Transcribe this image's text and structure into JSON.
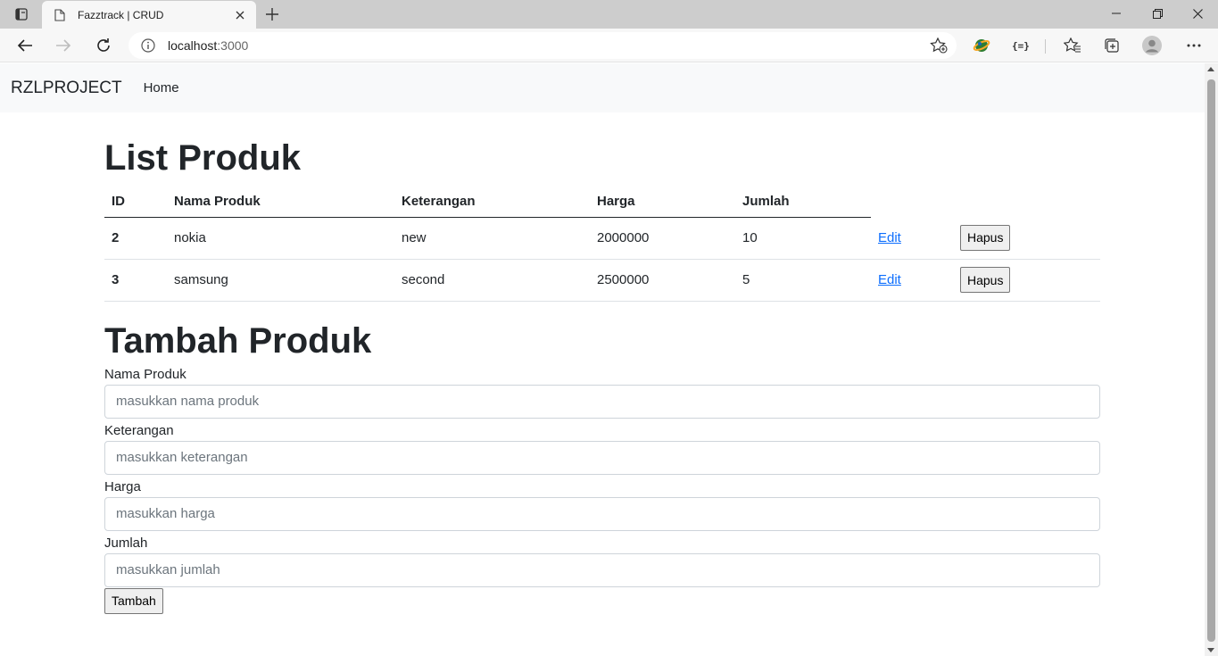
{
  "browser": {
    "tab_title": "Fazztrack | CRUD",
    "url_host": "localhost",
    "url_port": ":3000"
  },
  "icons": {
    "tab_actions": "tab-actions-icon",
    "page": "page-icon",
    "close": "close-icon",
    "new_tab": "plus-icon",
    "back": "back-arrow-icon",
    "forward": "forward-arrow-icon",
    "reload": "reload-icon",
    "info": "info-icon",
    "add_favorite": "star-plus-icon",
    "extension_1": "extension-globe-icon",
    "extension_2": "json-braces-icon",
    "favorites": "favorites-icon",
    "collections": "collections-icon",
    "profile": "profile-icon",
    "menu": "more-icon"
  },
  "navbar": {
    "brand": "RZLPROJECT",
    "link_home": "Home"
  },
  "list": {
    "heading": "List Produk",
    "columns": [
      "ID",
      "Nama Produk",
      "Keterangan",
      "Harga",
      "Jumlah"
    ],
    "rows": [
      {
        "id": "2",
        "nama": "nokia",
        "keterangan": "new",
        "harga": "2000000",
        "jumlah": "10",
        "edit": "Edit",
        "hapus": "Hapus"
      },
      {
        "id": "3",
        "nama": "samsung",
        "keterangan": "second",
        "harga": "2500000",
        "jumlah": "5",
        "edit": "Edit",
        "hapus": "Hapus"
      }
    ]
  },
  "form": {
    "heading": "Tambah Produk",
    "nama_label": "Nama Produk",
    "nama_placeholder": "masukkan nama produk",
    "keterangan_label": "Keterangan",
    "keterangan_placeholder": "masukkan keterangan",
    "harga_label": "Harga",
    "harga_placeholder": "masukkan harga",
    "jumlah_label": "Jumlah",
    "jumlah_placeholder": "masukkan jumlah",
    "submit_label": "Tambah"
  },
  "colors": {
    "link": "#0d6efd",
    "navbar_bg": "#f8f9fa",
    "text": "#212529"
  }
}
